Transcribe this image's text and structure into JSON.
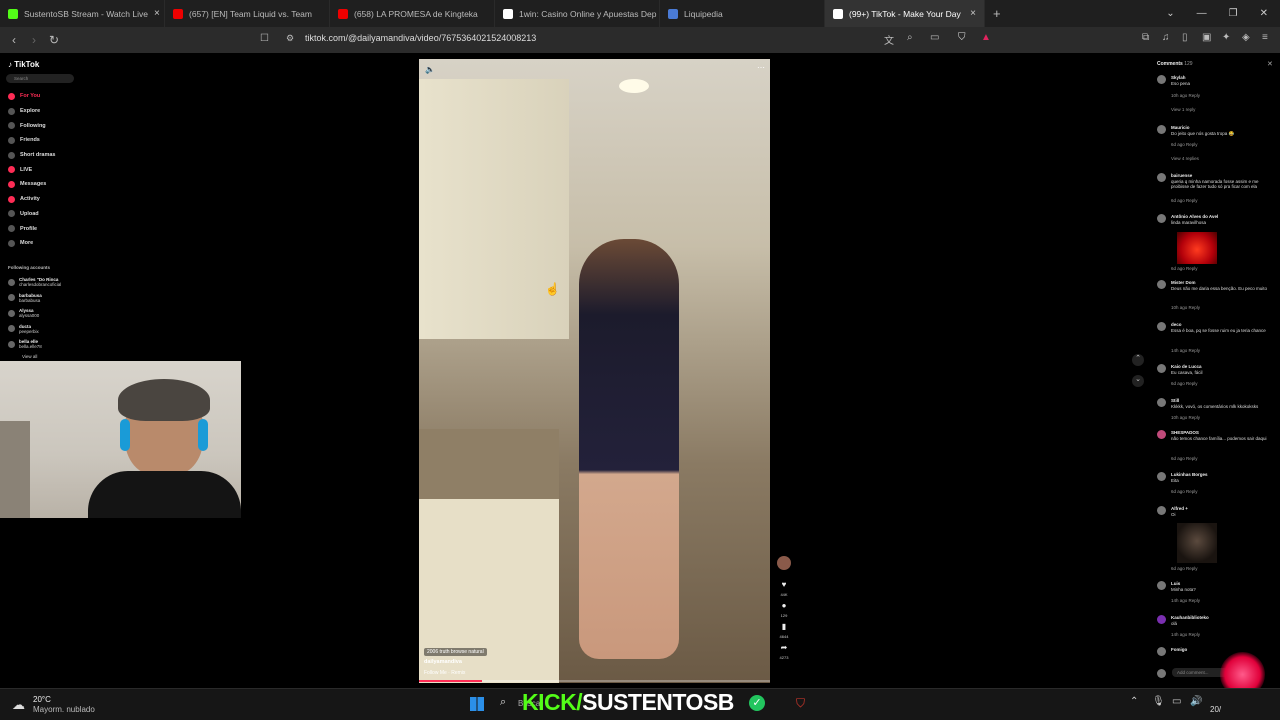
{
  "tabs": [
    {
      "label": "SustentoSB Stream - Watch Live",
      "color": "#53fc18"
    },
    {
      "label": "(657) [EN] Team Liquid vs. Team",
      "color": "#ff0000"
    },
    {
      "label": "(658) LA PROMESA de Kingteka",
      "color": "#ff0000"
    },
    {
      "label": "1win: Casino Online y Apuestas Dep",
      "color": "#ffffff"
    },
    {
      "label": "Liquipedia",
      "color": "#4a7bd6"
    },
    {
      "label": "(99+) TikTok - Make Your Day",
      "color": "#ffffff"
    }
  ],
  "address": {
    "url": "tiktok.com/@dailyamandiva/video/7675364021524008213"
  },
  "tiktok": {
    "logo": "TikTok",
    "search_placeholder": "Search",
    "nav": [
      "For You",
      "Explore",
      "Following",
      "Friends",
      "Short dramas",
      "LIVE",
      "Messages",
      "Activity",
      "Upload",
      "Profile",
      "More"
    ],
    "following_title": "Following accounts",
    "accounts": [
      {
        "name": "Charles \"Do Rinca",
        "handle": "charlesdobrancoficial"
      },
      {
        "name": "barbabusa",
        "handle": "barbabusa"
      },
      {
        "name": "Alyssa",
        "handle": "alyssa000"
      },
      {
        "name": "ducta",
        "handle": "peeperbix"
      },
      {
        "name": "bella elle",
        "handle": "bella.elle78"
      }
    ],
    "view_all": "View all"
  },
  "video": {
    "chip": "2006 truth browse natural",
    "author": "dailyamandiva",
    "music": "Follow Me · Remix",
    "actions": [
      {
        "icon": "heart-icon",
        "count": "44K"
      },
      {
        "icon": "comment-icon",
        "count": "129"
      },
      {
        "icon": "bookmark-icon",
        "count": "4644"
      },
      {
        "icon": "share-icon",
        "count": "4273"
      }
    ]
  },
  "comments": {
    "header": "Comments",
    "count": "129",
    "list": [
      {
        "user": "Skylah",
        "text": "Eso pena",
        "meta": "10h ago   Reply",
        "extra": "View 1 reply"
      },
      {
        "user": "Mauricio",
        "text": "Do jeito que nós gosta tropa 😂",
        "meta": "6d ago   Reply",
        "extra": "View 4 replies"
      },
      {
        "user": "bairuense",
        "text": "queria q minha namorada fosse assim e me proibisse de fazer tudo só pra ficar com ela",
        "meta": "6d ago   Reply",
        "extra": ""
      },
      {
        "user": "Antônio Alves do Avel",
        "text": "linda maravilhosa",
        "meta": "6d ago   Reply",
        "extra": ""
      },
      {
        "user": "Mister Dom",
        "text": "Deus não me daria essa benção. Eu peco muito",
        "meta": "10h ago   Reply",
        "extra": ""
      },
      {
        "user": "deco",
        "text": "Essa é boa, pq se fosse ruim eu ja teria chance",
        "meta": "14h ago   Reply",
        "extra": ""
      },
      {
        "user": "Kaio de Lucca",
        "text": "Eu casava, fácil",
        "meta": "6d ago   Reply",
        "extra": ""
      },
      {
        "user": "Still",
        "text": "Kkkkk, vovó, os comentários mlk kkokoksks",
        "meta": "10h ago   Reply",
        "extra": ""
      },
      {
        "user": "SHESPADOS",
        "text": "não temos chance família... podemos sair daqui",
        "meta": "6d ago   Reply",
        "extra": ""
      },
      {
        "user": "Lukinhas Borges",
        "text": "Eita",
        "meta": "6d ago   Reply",
        "extra": ""
      },
      {
        "user": "Alfred +",
        "text": "Oi",
        "meta": "6d ago   Reply",
        "extra": ""
      },
      {
        "user": "Luis",
        "text": "Minha nota?",
        "meta": "14h ago   Reply",
        "extra": ""
      },
      {
        "user": "Kauhanbiblioteko",
        "text": "olá",
        "meta": "14h ago   Reply",
        "extra": ""
      },
      {
        "user": "Fomigo",
        "text": "",
        "meta": "",
        "extra": ""
      }
    ],
    "add_placeholder": "Add comment..."
  },
  "taskbar": {
    "temp": "20°C",
    "weather": "Mayorm. nublado",
    "search": "Buscar",
    "kick_prefix": "KICK/",
    "kick_name": "SUSTENTOSB",
    "date": "20/"
  }
}
